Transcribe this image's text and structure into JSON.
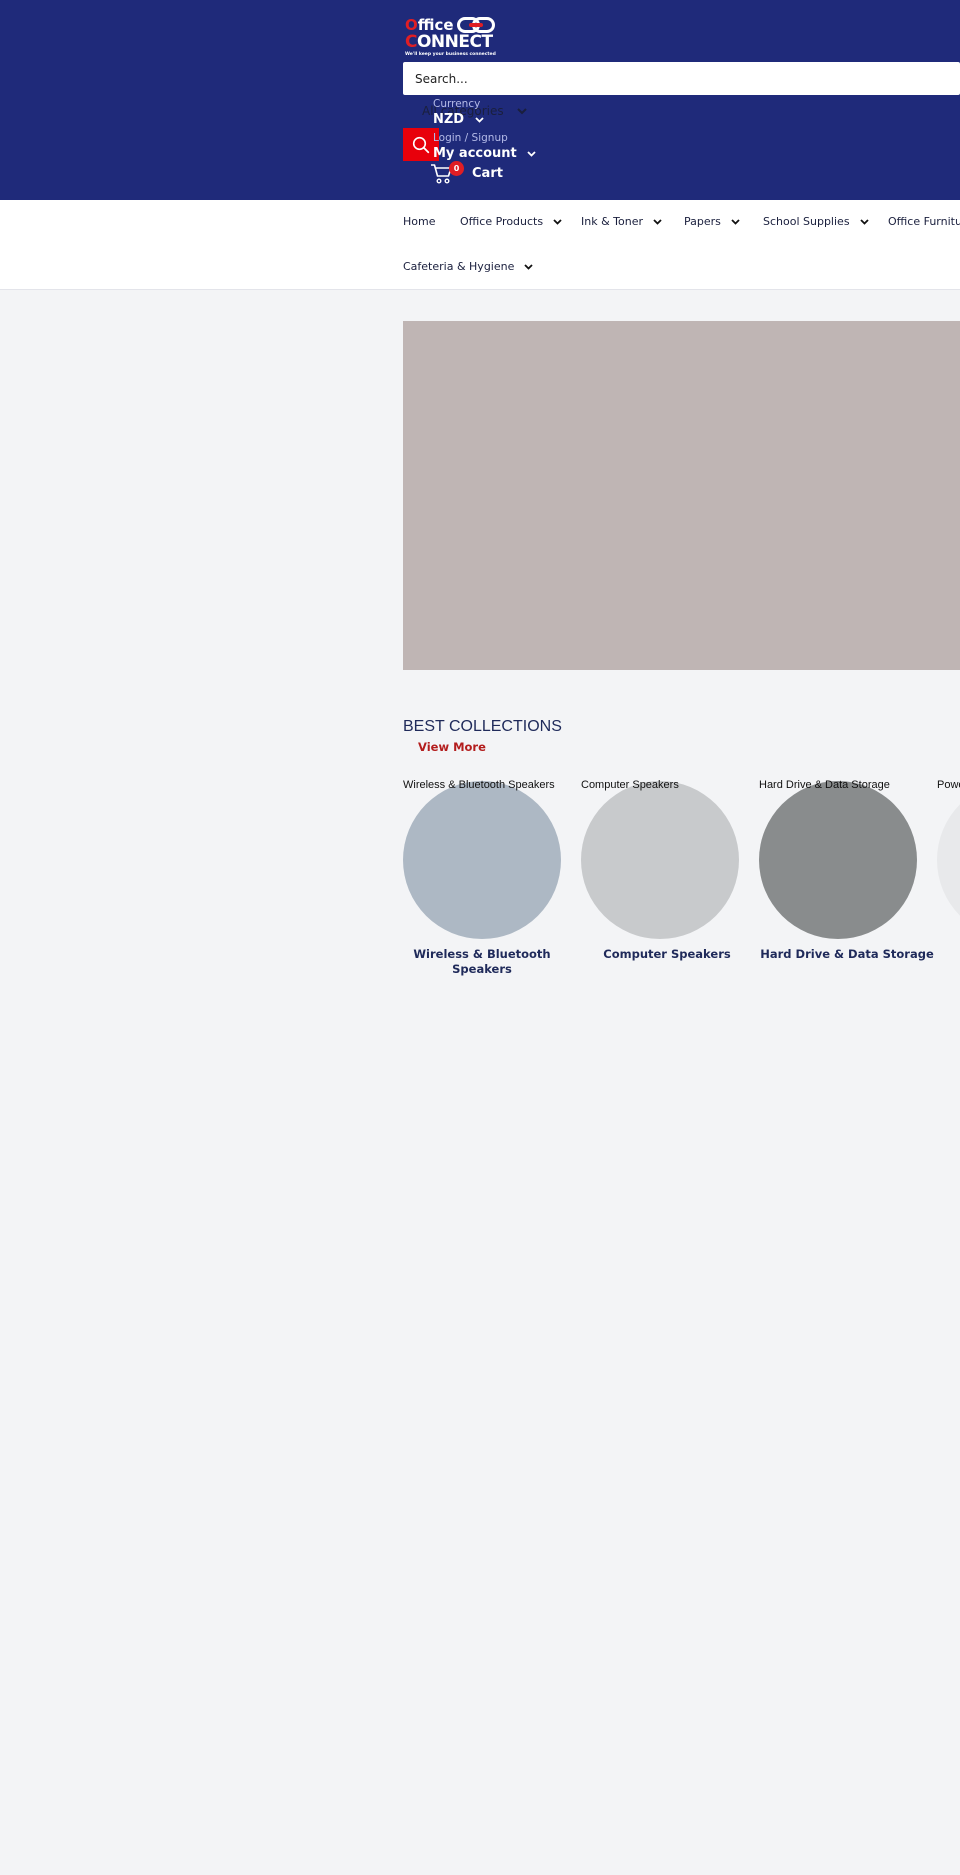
{
  "header": {
    "logo": {
      "line1_first": "O",
      "line1_rest": "ffice",
      "line2_first": "C",
      "line2_rest": "ONNECT",
      "tagline": "We'll keep your business connected"
    },
    "search": {
      "placeholder": "Search...",
      "value": "",
      "category_label": "All categories",
      "search_icon": "search-icon"
    },
    "currency": {
      "label": "Currency",
      "value": "NZD"
    },
    "account": {
      "label": "Login / Signup",
      "value": "My account"
    },
    "cart": {
      "count": "0",
      "label": "Cart",
      "icon": "cart-icon"
    },
    "colors": {
      "brand_navy": "#1f2a7a",
      "accent_red": "#e8000b"
    }
  },
  "nav": {
    "items": [
      {
        "label": "Home",
        "has_dropdown": false
      },
      {
        "label": "Office Products",
        "has_dropdown": true
      },
      {
        "label": "Ink & Toner",
        "has_dropdown": true
      },
      {
        "label": "Papers",
        "has_dropdown": true
      },
      {
        "label": "School Supplies",
        "has_dropdown": true
      },
      {
        "label": "Office Furniture",
        "has_dropdown": false
      },
      {
        "label": "Cafeteria & Hygiene",
        "has_dropdown": true
      }
    ]
  },
  "hero": {
    "placeholder_color": "#bfb5b4"
  },
  "collections": {
    "title": "BEST COLLECTIONS",
    "view_more": "View More",
    "items": [
      {
        "alt": "Wireless & Bluetooth Speakers",
        "name": "Wireless & Bluetooth Speakers",
        "color": "#adb8c4"
      },
      {
        "alt": "Computer Speakers",
        "name": "Computer Speakers",
        "color": "#c8cacc"
      },
      {
        "alt": "Hard Drive & Data Storage",
        "name": "Hard Drive & Data Storage",
        "color": "#898c8d"
      },
      {
        "alt": "Power",
        "name": "",
        "color": "#e8e9eb"
      }
    ]
  }
}
